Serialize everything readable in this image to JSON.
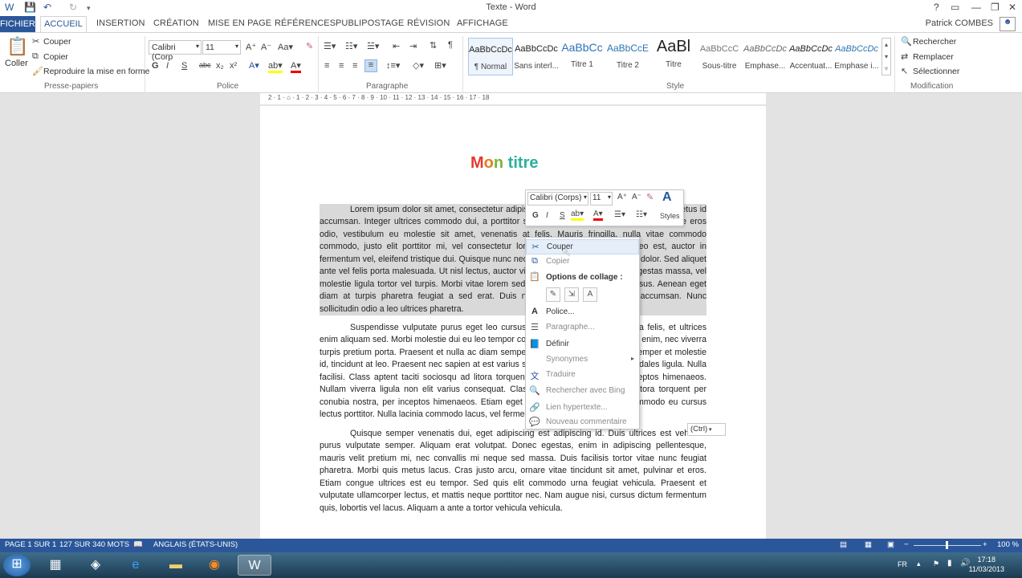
{
  "window": {
    "title": "Texte - Word",
    "user": "Patrick COMBES"
  },
  "tabs": [
    "FICHIER",
    "ACCUEIL",
    "INSERTION",
    "CRÉATION",
    "MISE EN PAGE",
    "RÉFÉRENCES",
    "PUBLIPOSTAGE",
    "RÉVISION",
    "AFFICHAGE"
  ],
  "clipboard": {
    "paste": "Coller",
    "cut": "Couper",
    "copy": "Copier",
    "format_painter": "Reproduire la mise en forme",
    "group": "Presse-papiers"
  },
  "font": {
    "name": "Calibri (Corp",
    "size": "11",
    "group": "Police",
    "bold": "G",
    "italic": "I",
    "underline": "S",
    "strike": "abc",
    "sub": "x₂",
    "sup": "x²"
  },
  "paragraph": {
    "group": "Paragraphe"
  },
  "styles": {
    "group": "Style",
    "items": [
      {
        "preview": "AaBbCcDc",
        "name": "¶ Normal"
      },
      {
        "preview": "AaBbCcDc",
        "name": "Sans interl..."
      },
      {
        "preview": "AaBbCc",
        "name": "Titre 1"
      },
      {
        "preview": "AaBbCcE",
        "name": "Titre 2"
      },
      {
        "preview": "AaBl",
        "name": "Titre"
      },
      {
        "preview": "AaBbCcC",
        "name": "Sous-titre"
      },
      {
        "preview": "AaBbCcDc",
        "name": "Emphase..."
      },
      {
        "preview": "AaBbCcDc",
        "name": "Accentuat..."
      },
      {
        "preview": "AaBbCcDc",
        "name": "Emphase i..."
      }
    ]
  },
  "editing": {
    "group": "Modification",
    "find": "Rechercher",
    "replace": "Remplacer",
    "select": "Sélectionner"
  },
  "ruler": "2 · 1 · ⌂ · 1 · 2 · 3 · 4 · 5 · 6 · 7 · 8 · 9 · 10 · 11 · 12 · 13 · 14 · 15 · 16 · 17 · 18",
  "document": {
    "title_letters": [
      {
        "ch": "M",
        "color": "#e23c2e"
      },
      {
        "ch": "o",
        "color": "#e77c1e"
      },
      {
        "ch": "n",
        "color": "#7ab535"
      },
      {
        "ch": " ",
        "color": "#000000"
      },
      {
        "ch": "t",
        "color": "#2bb09c"
      },
      {
        "ch": "i",
        "color": "#2bb09c"
      },
      {
        "ch": "t",
        "color": "#2bb09c"
      },
      {
        "ch": "r",
        "color": "#2bb09c"
      },
      {
        "ch": "e",
        "color": "#2bb09c"
      }
    ],
    "para1": "Lorem ipsum dolor sit amet, consectetur adipiscing elit. Mauris tristique pellentesque metus id accumsan. Integer ultrices commodo dui, a porttitor sem egestas turpis tincidunt. Suspendisse eros odio, vestibulum eu molestie sit amet, venenatis at felis. Mauris fringilla, nulla vitae commodo commodo, justo elit porttitor mi, vel consectetur lorem sem vel leo. Curabitur leo est, auctor in fermentum vel, eleifend tristique dui. Quisque nunc neque, tempor sed condimentum dolor. Sed aliquet ante vel felis porta malesuada. Ut nisl lectus, auctor vitae erat id, feugiat, eros est egestas massa, vel molestie ligula tortor vel turpis. Morbi vitae lorem sed nunc pulvinar in adipiscing risus. Aenean eget diam at turpis pharetra feugiat a sed erat. Duis nec ligula quis dolor dictum accumsan. Nunc sollicitudin odio a leo ultrices pharetra.",
    "para2": "Suspendisse vulputate purus eget leo cursus sodales. Curabitur vitae nulla felis, et ultrices enim aliquam sed. Morbi molestie dui eu leo tempor condimentum. Vivamus tincidunt enim, nec viverra turpis pretium porta. Praesent et nulla ac diam semper placerat quis metus nunc, semper et molestie id, tincidunt at leo. Praesent nec sapien at est varius semper, purus sem, lobortis sodales ligula. Nulla facilisi. Class aptent taciti sociosqu ad litora torquent per conubia nostra, per inceptos himenaeos. Nullam viverra ligula non elit varius consequat. Class aptent taciti sociosqu ad litora torquent per conubia nostra, per inceptos himenaeos. Etiam eget erat vel purus porta justo commodo eu cursus lectus porttitor. Nulla lacinia commodo lacus, vel fermentum augue posuere purus.",
    "para3": "Quisque semper venenatis dui, eget adipiscing est adipiscing id. Duis ultrices est vehicula purus vulputate semper. Aliquam erat volutpat. Donec egestas, enim in adipiscing pellentesque, mauris velit pretium mi, nec convallis mi neque sed massa. Duis facilisis tortor vitae nunc feugiat pharetra. Morbi quis metus lacus. Cras justo arcu, ornare vitae tincidunt sit amet, pulvinar et eros. Etiam congue ultrices est eu tempor. Sed quis elit commodo urna feugiat vehicula. Praesent et vulputate ullamcorper lectus, et mattis neque porttitor nec. Nam augue nisi, cursus dictum fermentum quis, lobortis vel lacus. Aliquam a ante a tortor vehicula vehicula."
  },
  "mini_toolbar": {
    "font": "Calibri (Corps)",
    "size": "11",
    "styles": "Styles"
  },
  "context_menu": {
    "cut": "Couper",
    "copy": "Copier",
    "paste_options": "Options de collage :",
    "font": "Police...",
    "paragraph": "Paragraphe...",
    "define": "Définir",
    "synonyms": "Synonymes",
    "translate": "Traduire",
    "search_bing": "Rechercher avec Bing",
    "hyperlink": "Lien hypertexte...",
    "new_comment": "Nouveau commentaire"
  },
  "paste_tag": "(Ctrl)",
  "status": {
    "page": "PAGE 1 SUR 1",
    "words": "127 SUR 340 MOTS",
    "language": "ANGLAIS (ÉTATS-UNIS)",
    "zoom": "100 %"
  },
  "taskbar": {
    "lang": "FR",
    "time": "17:18",
    "date": "11/03/2013"
  }
}
